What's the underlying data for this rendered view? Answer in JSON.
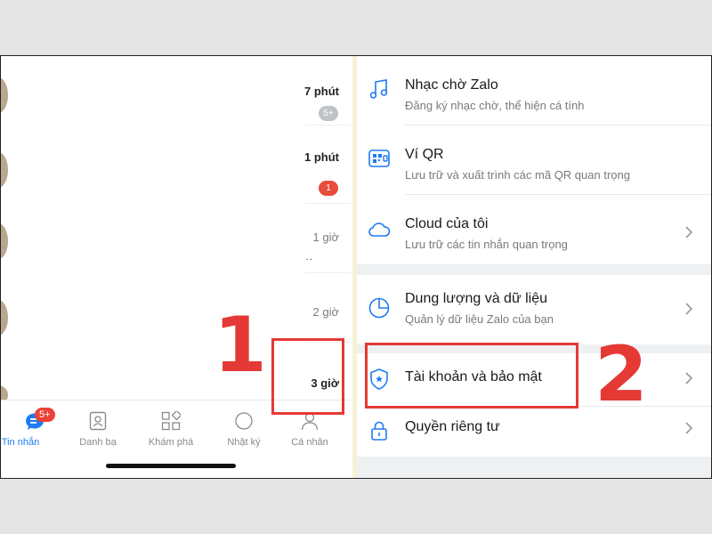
{
  "left_panel": {
    "chat_rows": [
      {
        "time": "7 phút",
        "time_style": "bold",
        "badge": "5+",
        "badge_color": "grey",
        "dots": ""
      },
      {
        "time": "1 phút",
        "time_style": "bold",
        "badge": "1",
        "badge_color": "red",
        "dots": ""
      },
      {
        "time": "1 giờ",
        "time_style": "light",
        "badge": "",
        "badge_color": "",
        "dots": ".."
      },
      {
        "time": "2 giờ",
        "time_style": "light",
        "badge": "",
        "badge_color": "",
        "dots": ""
      },
      {
        "time": "3 giờ",
        "time_style": "bold",
        "badge": "",
        "badge_color": "",
        "dots": ""
      }
    ],
    "bottom_nav": {
      "messages_label": "Tin nhắn",
      "messages_badge": "5+",
      "contacts_label": "Danh bạ",
      "discover_label": "Khám phá",
      "timeline_label": "Nhật ký",
      "profile_label": "Cá nhân"
    },
    "callout_number": "1"
  },
  "right_panel": {
    "items": [
      {
        "title": "Nhạc chờ Zalo",
        "subtitle": "Đăng ký nhạc chờ, thể hiện cá tính",
        "icon": "music-note-icon"
      },
      {
        "title": "Ví QR",
        "subtitle": "Lưu trữ và xuất trình các mã QR quan trọng",
        "icon": "qr-wallet-icon"
      },
      {
        "title": "Cloud của tôi",
        "subtitle": "Lưu trữ các tin nhắn quan trọng",
        "icon": "cloud-icon"
      },
      {
        "title": "Dung lượng và dữ liệu",
        "subtitle": "Quản lý dữ liệu Zalo của bạn",
        "icon": "pie-chart-icon"
      },
      {
        "title": "Tài khoản và bảo mật",
        "subtitle": "",
        "icon": "shield-icon"
      },
      {
        "title": "Quyền riêng tư",
        "subtitle": "",
        "icon": "lock-icon"
      }
    ],
    "callout_number": "2"
  },
  "colors": {
    "accent_blue": "#1d7cf2",
    "callout_red": "#e53935",
    "badge_red": "#ea4335"
  }
}
